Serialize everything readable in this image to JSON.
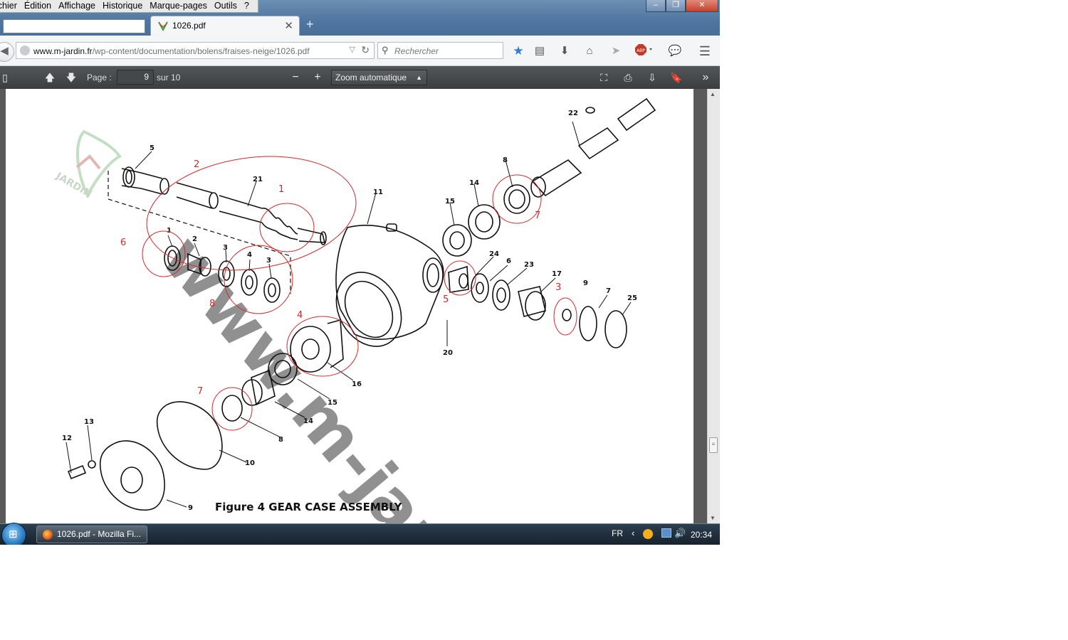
{
  "menu": [
    "ichier",
    "Édition",
    "Affichage",
    "Historique",
    "Marque-pages",
    "Outils",
    "?"
  ],
  "window_buttons": [
    "–",
    "❐",
    "✕"
  ],
  "tab": {
    "title": "1026.pdf",
    "close": "✕",
    "new": "+"
  },
  "nav": {
    "url_domain": "www.m-jardin.fr",
    "url_path": "/wp-content/documentation/bolens/fraises-neige/1026.pdf",
    "search_placeholder": "Rechercher"
  },
  "pdf_toolbar": {
    "page_label": "Page :",
    "page_value": "9",
    "page_total": "sur 10",
    "zoom": "Zoom automatique",
    "zoom_minus": "−",
    "zoom_plus": "+"
  },
  "figure": {
    "caption": "Figure 4  GEAR CASE ASSEMBLY",
    "watermark": "www.m-jar",
    "logo_text": "JARDIN",
    "part_labels": [
      "5",
      "21",
      "1",
      "2",
      "3",
      "4",
      "3",
      "11",
      "8",
      "14",
      "15",
      "22",
      "24",
      "6",
      "23",
      "17",
      "9",
      "7",
      "25",
      "20",
      "16",
      "15",
      "14",
      "8",
      "10",
      "9",
      "12",
      "13"
    ],
    "red_labels": [
      "2",
      "1",
      "6",
      "8",
      "4",
      "7",
      "5",
      "3",
      "7"
    ]
  },
  "taskbar": {
    "item": "1026.pdf - Mozilla Fi...",
    "lang": "FR",
    "clock": "20:34"
  },
  "colors": {
    "pdf_toolbar": "#45484b",
    "annotation_red": "#d22a2a",
    "taskbar": "#1f2e3b"
  },
  "icons": [
    "firefox-icon",
    "bookmark-star-icon",
    "reading-list-icon",
    "download-icon",
    "home-icon",
    "send-icon",
    "adblock-icon",
    "chat-icon",
    "menu-icon",
    "sidebar-toggle-icon",
    "prev-page-icon",
    "next-page-icon",
    "fullscreen-icon",
    "print-icon",
    "save-icon",
    "bookmark-icon",
    "more-tools-icon"
  ]
}
